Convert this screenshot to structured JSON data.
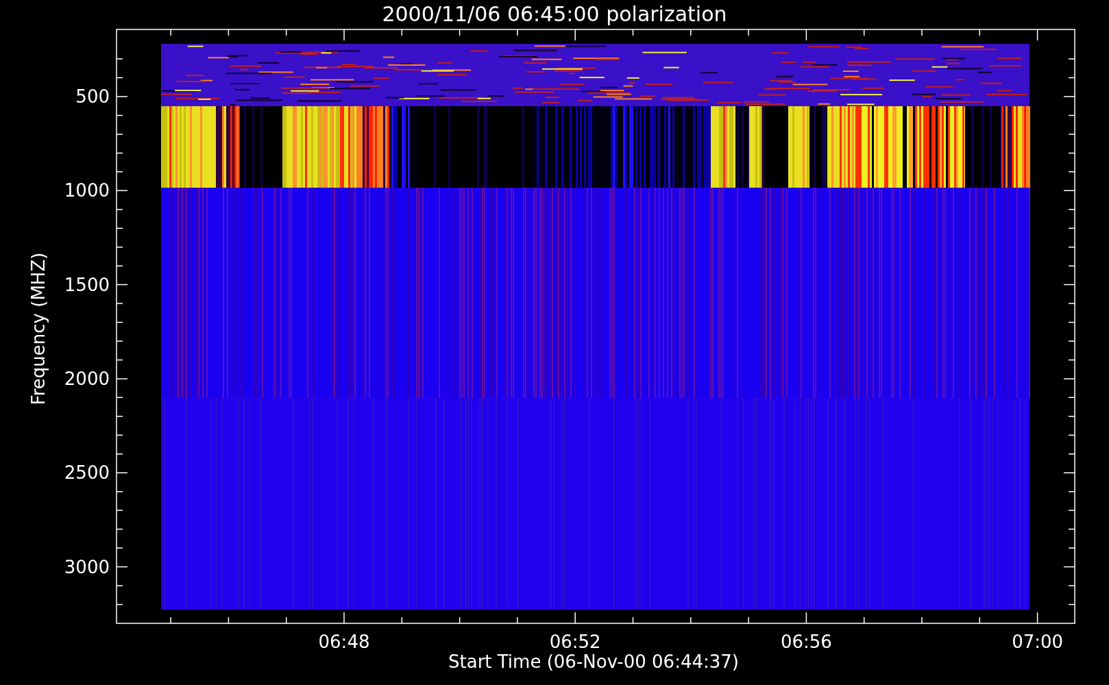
{
  "title": "2000/11/06 06:45:00 polarization",
  "y_axis": {
    "label": "Frequency (MHZ)",
    "ticks": [
      "500",
      "1000",
      "1500",
      "2000",
      "2500",
      "3000"
    ]
  },
  "x_axis": {
    "label": "Start Time (06-Nov-00 06:44:37)",
    "ticks": [
      "06:48",
      "06:52",
      "06:56",
      "07:00"
    ]
  }
}
